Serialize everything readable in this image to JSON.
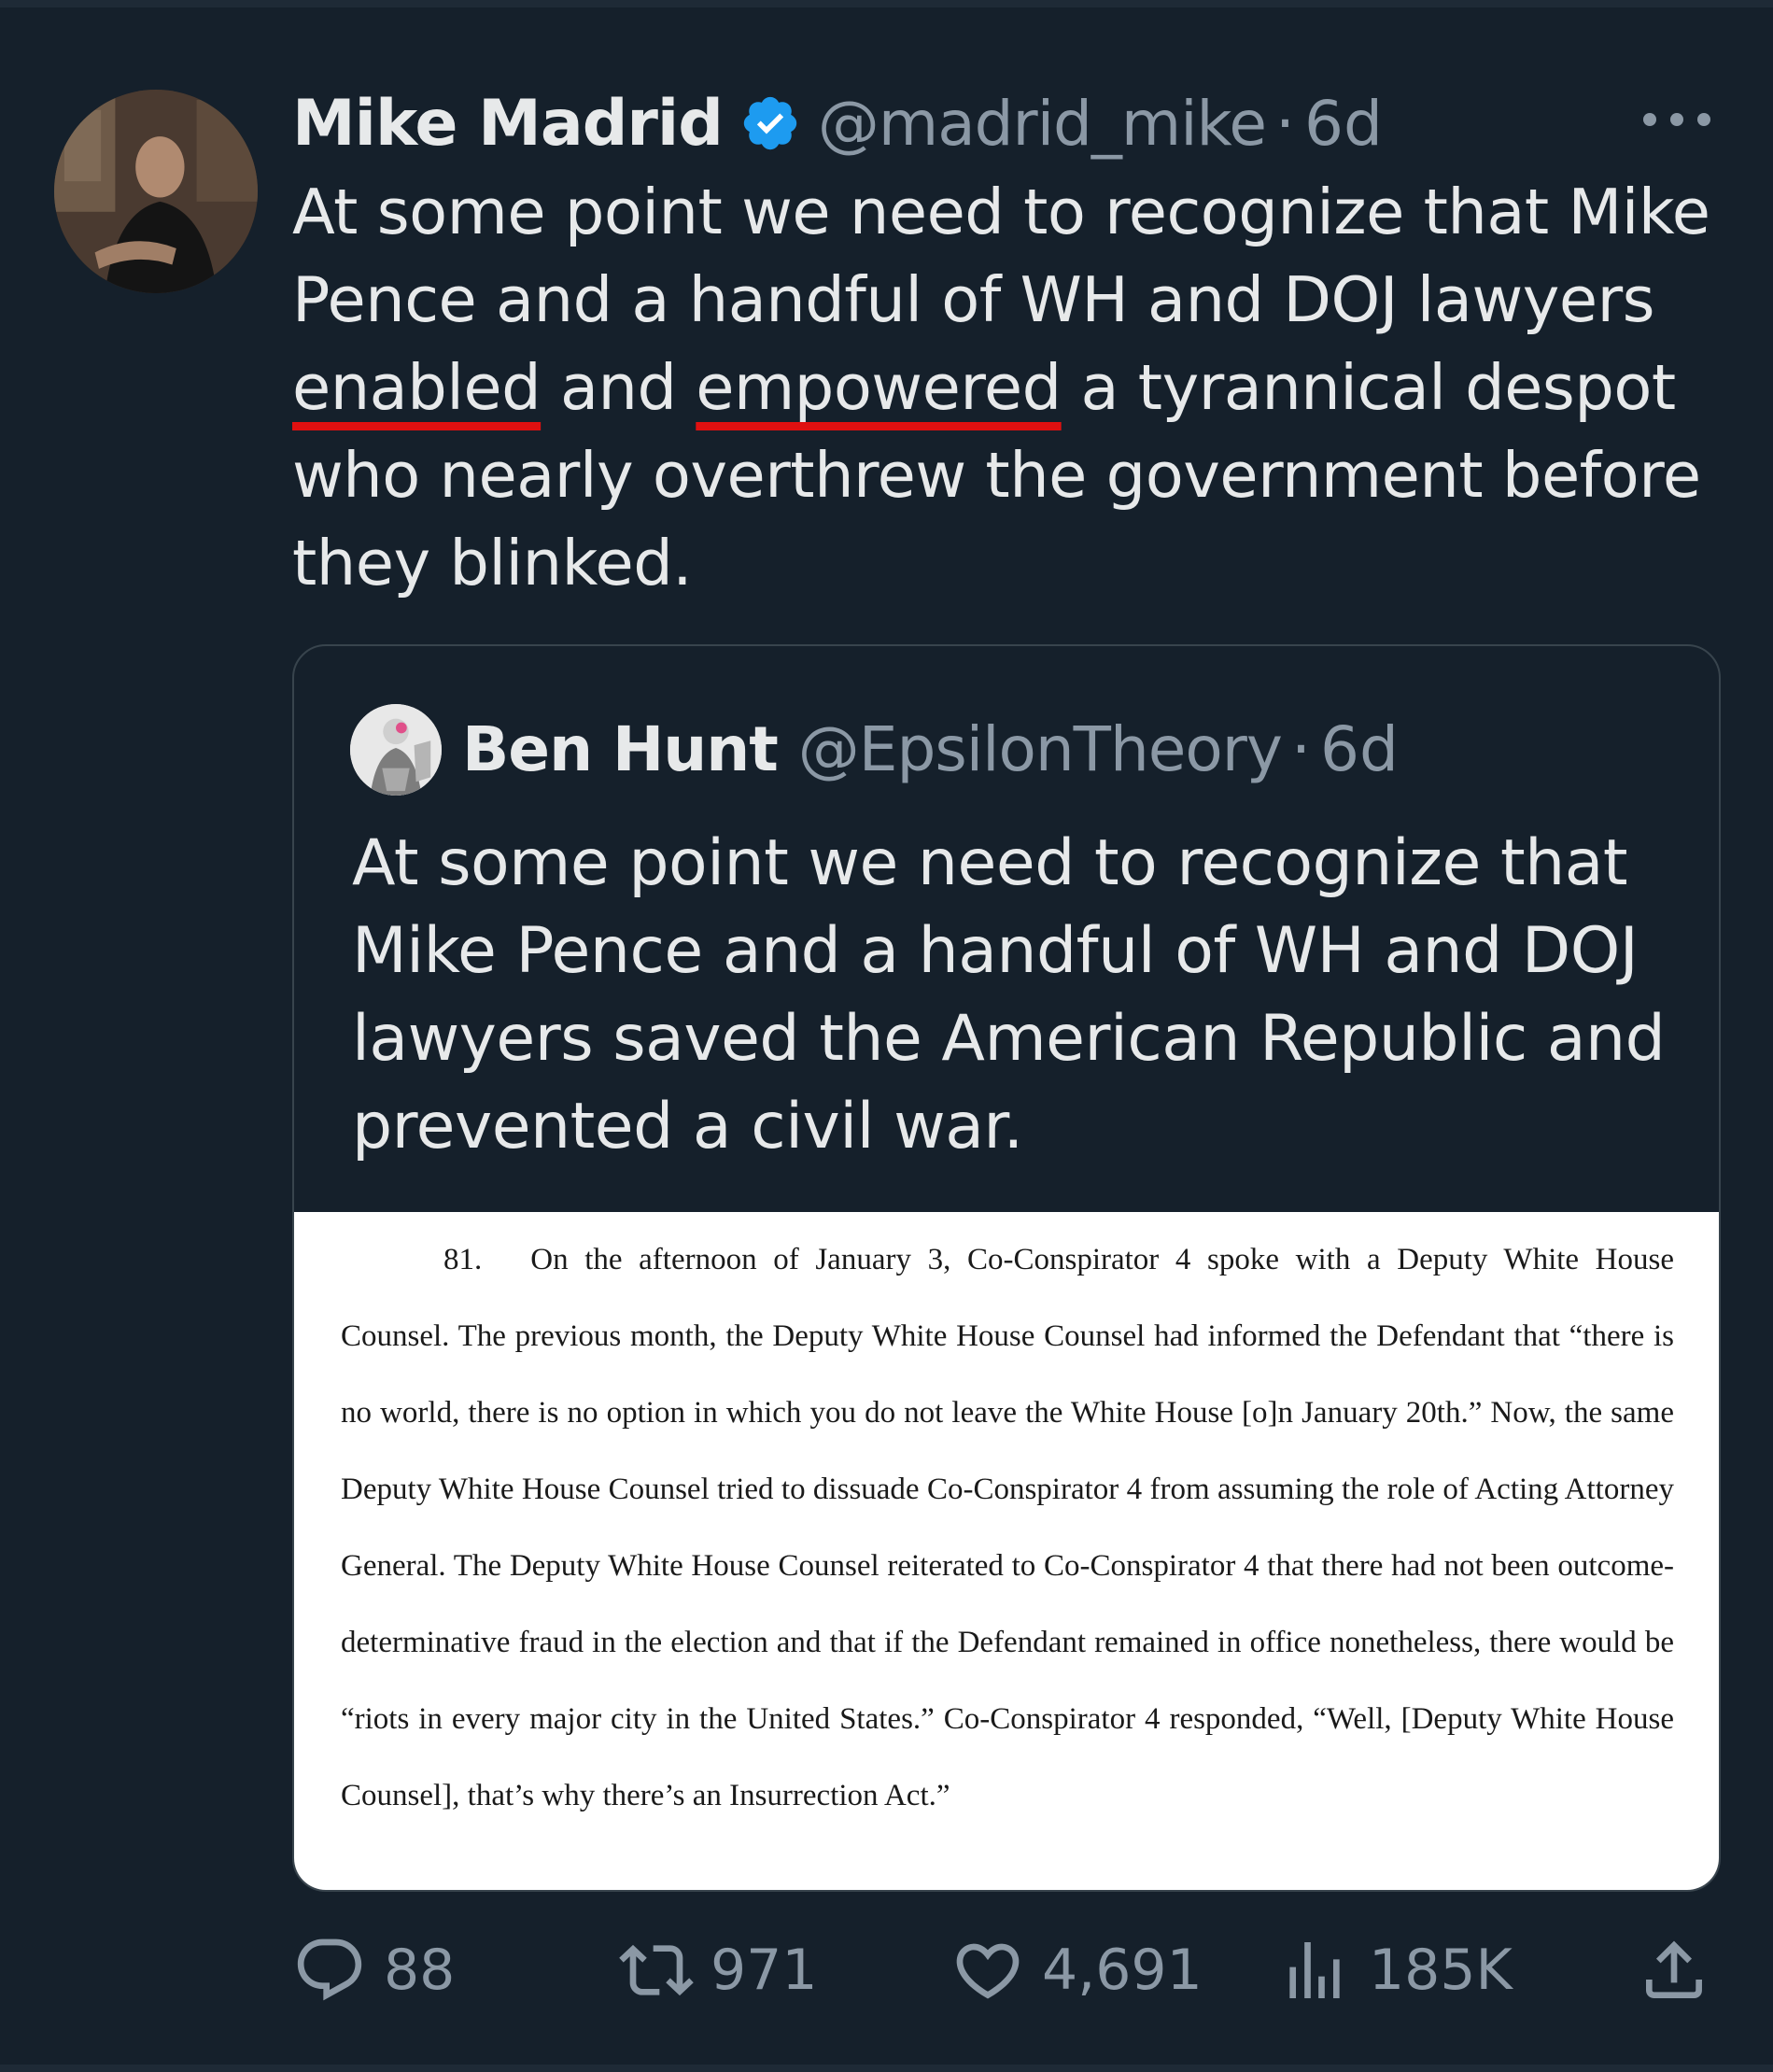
{
  "tweet": {
    "author": {
      "name": "Mike Madrid",
      "handle": "@madrid_mike",
      "separator": "·",
      "time": "6d",
      "verified": true
    },
    "text_parts": {
      "p1": "At some point we need to recognize that Mike Pence and a handful of WH and DOJ lawyers ",
      "enabled": "enabled",
      "p2": " and ",
      "empowered": "empowered",
      "p3": " a tyrannical despot who nearly overthrew the government before they blinked."
    },
    "quoted": {
      "name": "Ben Hunt",
      "handle": "@EpsilonTheory",
      "separator": "·",
      "time": "6d",
      "text": "At some point we need to recognize that Mike Pence and a handful of WH and DOJ lawyers saved the American Republic and prevented a civil war.",
      "document": {
        "paragraph_number": "81.",
        "paragraph_text": "On the afternoon of January 3, Co-Conspirator 4 spoke with a Deputy White House Counsel.  The previous month, the Deputy White House Counsel had informed the Defendant that “there is no world, there is no option in which you do not leave the White House [o]n January 20th.”  Now, the same Deputy White House Counsel tried to dissuade Co-Conspirator 4 from assuming the role of Acting Attorney General.  The Deputy White House Counsel reiterated to Co-Conspirator 4 that there had not been outcome-determinative fraud in the election and that if the Defendant remained in office nonetheless, there would be “riots in every major city in the United States.”  Co-Conspirator 4 responded, “Well, [Deputy White House Counsel], that’s why there’s an Insurrection Act.”"
      }
    },
    "actions": {
      "replies": "88",
      "retweets": "971",
      "likes": "4,691",
      "views": "185K"
    },
    "colors": {
      "background": "#15202b",
      "text": "#e7e9ea",
      "muted": "#8b98a5",
      "verified_blue": "#1d9bf0",
      "underline_red": "#e01010",
      "border": "#38444d"
    },
    "icons": [
      "verified-badge-icon",
      "more-icon",
      "reply-icon",
      "retweet-icon",
      "like-icon",
      "views-icon",
      "share-icon"
    ]
  }
}
